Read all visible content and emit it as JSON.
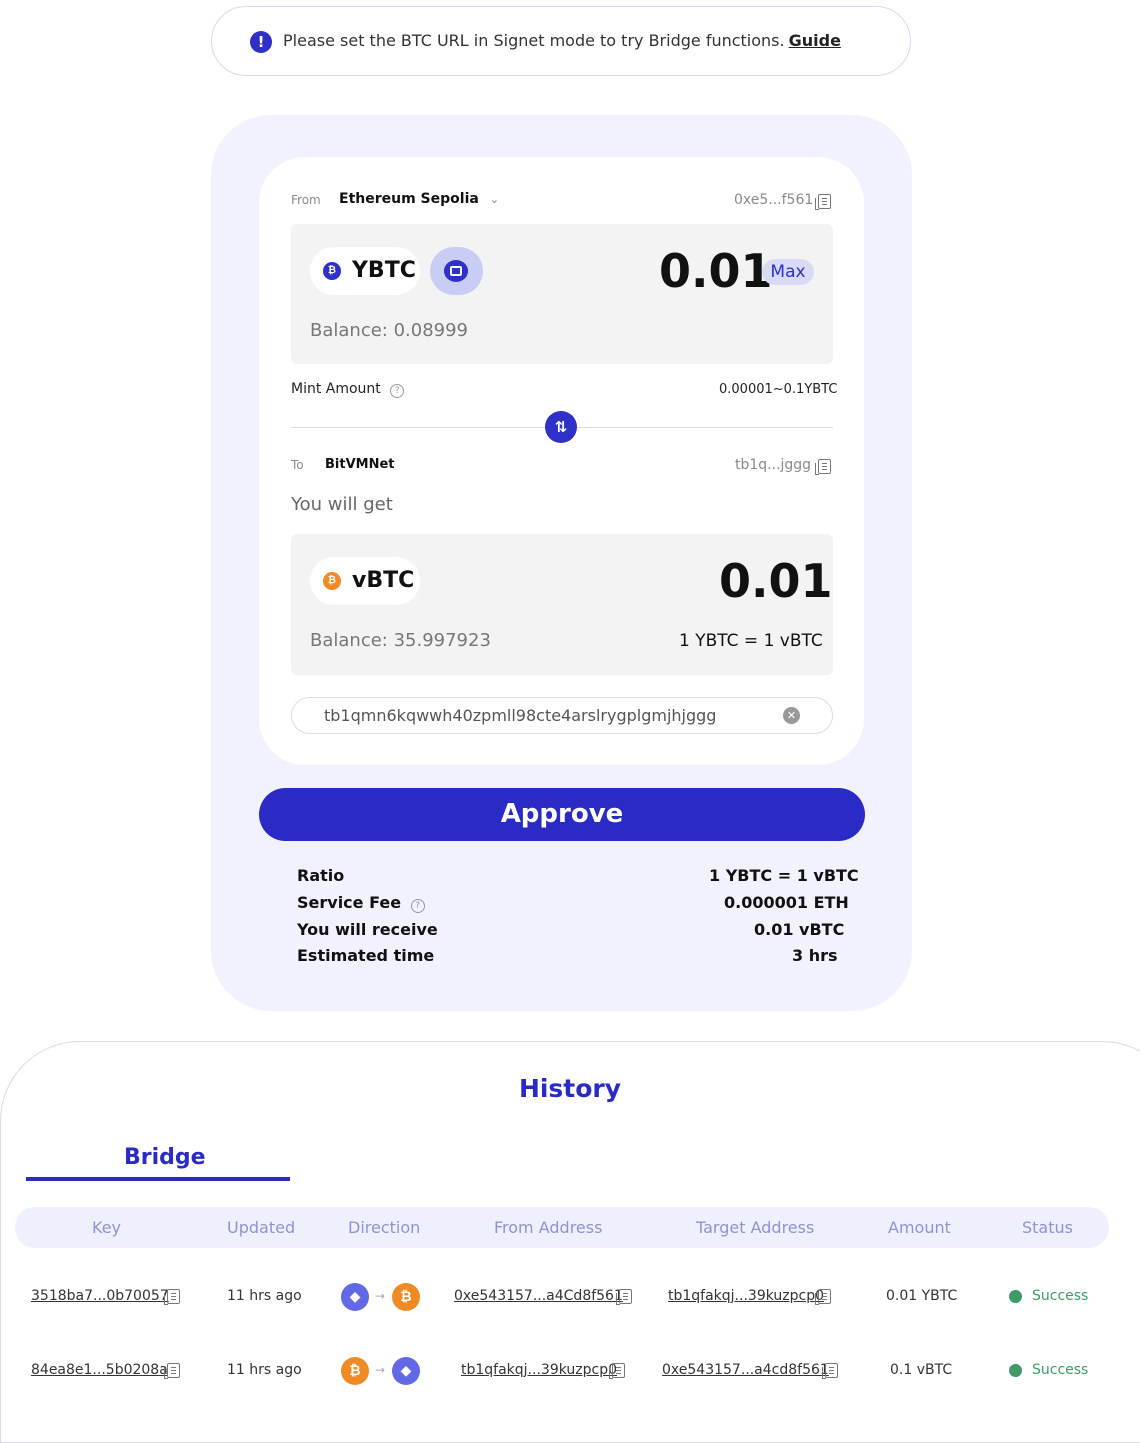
{
  "notice": {
    "text": "Please set the BTC URL in Signet mode to try Bridge functions.",
    "link": "Guide"
  },
  "from": {
    "label": "From",
    "network": "Ethereum Sepolia",
    "address": "0xe5...f561",
    "token": "YBTC",
    "amount": "0.01",
    "max_label": "Max",
    "balance": "Balance: 0.08999"
  },
  "mint": {
    "label": "Mint Amount",
    "range": "0.00001~0.1YBTC"
  },
  "to": {
    "label": "To",
    "network": "BitVMNet",
    "address": "tb1q...jggg",
    "you_will_get": "You will get",
    "token": "vBTC",
    "amount": "0.01",
    "balance": "Balance: 35.997923",
    "rate": "1 YBTC = 1 vBTC",
    "target_address_value": "tb1qmn6kqwwh40zpmll98cte4arslrygplgmjhjggg"
  },
  "approve_label": "Approve",
  "info": {
    "ratio_label": "Ratio",
    "ratio_value": "1 YBTC = 1 vBTC",
    "fee_label": "Service Fee",
    "fee_value": "0.000001 ETH",
    "receive_label": "You will receive",
    "receive_value": "0.01 vBTC",
    "time_label": "Estimated time",
    "time_value": "3 hrs"
  },
  "history": {
    "title": "History",
    "tab": "Bridge",
    "columns": [
      "Key",
      "Updated",
      "Direction",
      "From Address",
      "Target Address",
      "Amount",
      "Status"
    ],
    "rows": [
      {
        "key": "3518ba7...0b70057",
        "updated": "11 hrs ago",
        "direction_from": "ethereum-icon",
        "direction_to": "bitcoin-icon",
        "from_address": "0xe543157...a4Cd8f561",
        "target_address": "tb1qfakqj...39kuzpcp0",
        "amount": "0.01 YBTC",
        "status": "Success"
      },
      {
        "key": "84ea8e1...5b0208a",
        "updated": "11 hrs ago",
        "direction_from": "bitcoin-icon",
        "direction_to": "ethereum-icon",
        "from_address": "tb1qfakqj...39kuzpcp0",
        "target_address": "0xe543157...a4cd8f561",
        "amount": "0.1 vBTC",
        "status": "Success"
      }
    ]
  },
  "colors": {
    "accent": "#2a2bc6",
    "success": "#3e9b67",
    "panel_bg": "#f1f2fd",
    "btc_orange": "#f08a24",
    "eth_purple": "#6368e6"
  }
}
